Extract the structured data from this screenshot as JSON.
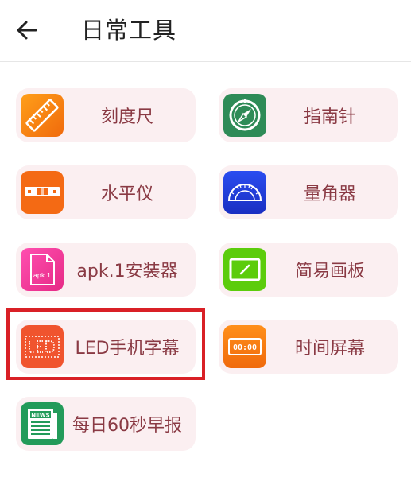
{
  "header": {
    "title": "日常工具",
    "back_icon": "arrow-left-icon"
  },
  "tools": [
    {
      "label": "刻度尺",
      "icon": "ruler-icon",
      "color": "#f7830f"
    },
    {
      "label": "指南针",
      "icon": "compass-icon",
      "color": "#2e8b57"
    },
    {
      "label": "水平仪",
      "icon": "spirit-level-icon",
      "color": "#f46a14"
    },
    {
      "label": "量角器",
      "icon": "protractor-icon",
      "color": "#1f3ed9"
    },
    {
      "label": "apk.1安装器",
      "icon": "apk-file-icon",
      "color": "#f0379a",
      "icon_text": "apk.1"
    },
    {
      "label": "简易画板",
      "icon": "drawing-board-icon",
      "color": "#5ccc0c"
    },
    {
      "label": "LED手机字幕",
      "icon": "led-subtitle-icon",
      "color": "#f0542e",
      "selected": true
    },
    {
      "label": "时间屏幕",
      "icon": "time-screen-icon",
      "color": "#f47a0c",
      "icon_text": "00:00"
    },
    {
      "label": "每日60秒早报",
      "icon": "news-icon",
      "color": "#239b5a",
      "icon_text": "NEWS"
    }
  ],
  "highlight_color": "#d92026"
}
